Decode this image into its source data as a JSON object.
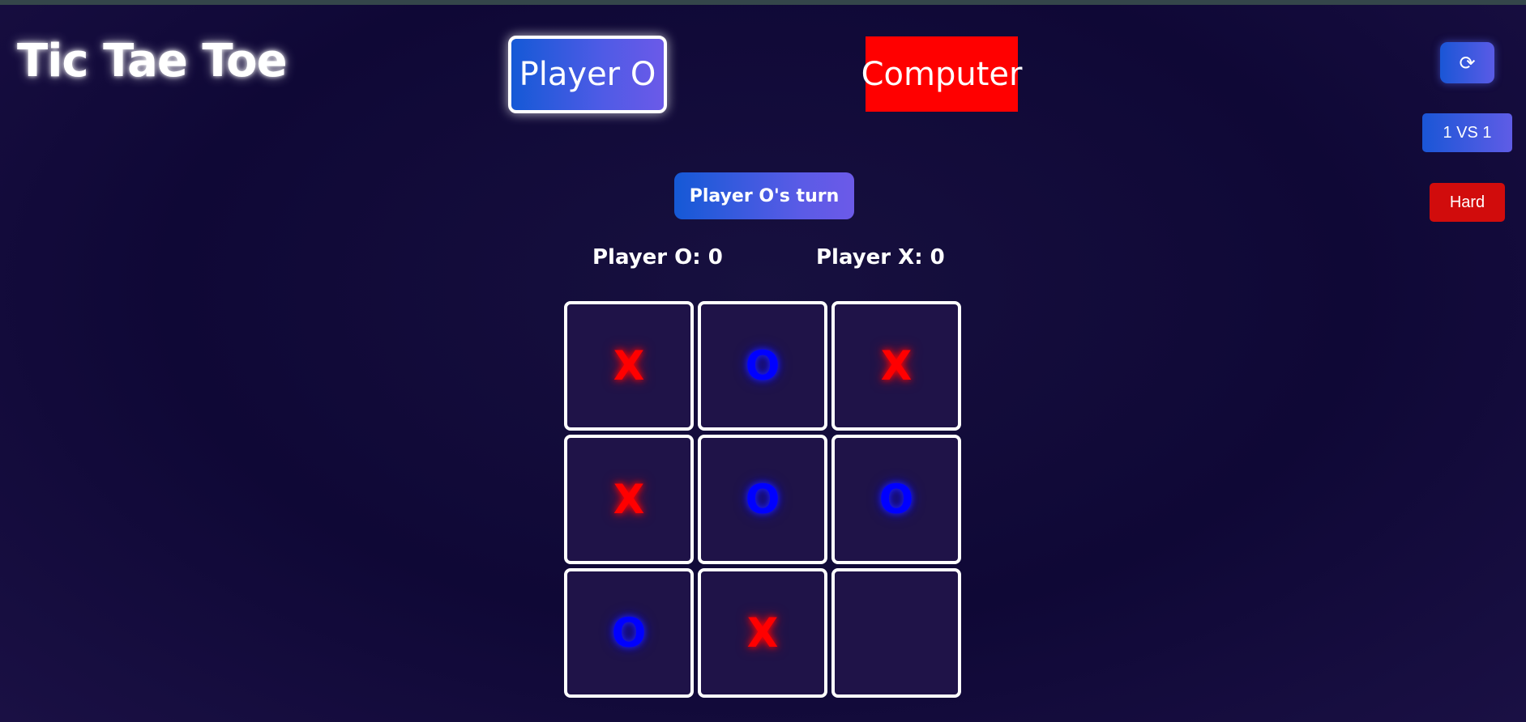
{
  "app": {
    "title": "Tic Tae Toe"
  },
  "players": {
    "active_label": "Player O",
    "opponent_label": "Computer"
  },
  "controls": {
    "reset_icon": "refresh-icon",
    "reset_glyph": "⟳",
    "mode_label": "1 VS 1",
    "difficulty_label": "Hard"
  },
  "status": {
    "turn_text": "Player O's turn"
  },
  "scores": {
    "o_text": "Player O: 0",
    "x_text": "Player X: 0",
    "o_value": 0,
    "x_value": 0
  },
  "board": {
    "cells": [
      "X",
      "O",
      "X",
      "X",
      "O",
      "O",
      "O",
      "X",
      ""
    ]
  },
  "colors": {
    "x_mark": "#ff0000",
    "o_mark": "#0000ff",
    "opponent_badge": "#ff0000",
    "difficulty_button": "#d10c0c",
    "background": "#0f0836",
    "cell_background": "#1f1348"
  }
}
